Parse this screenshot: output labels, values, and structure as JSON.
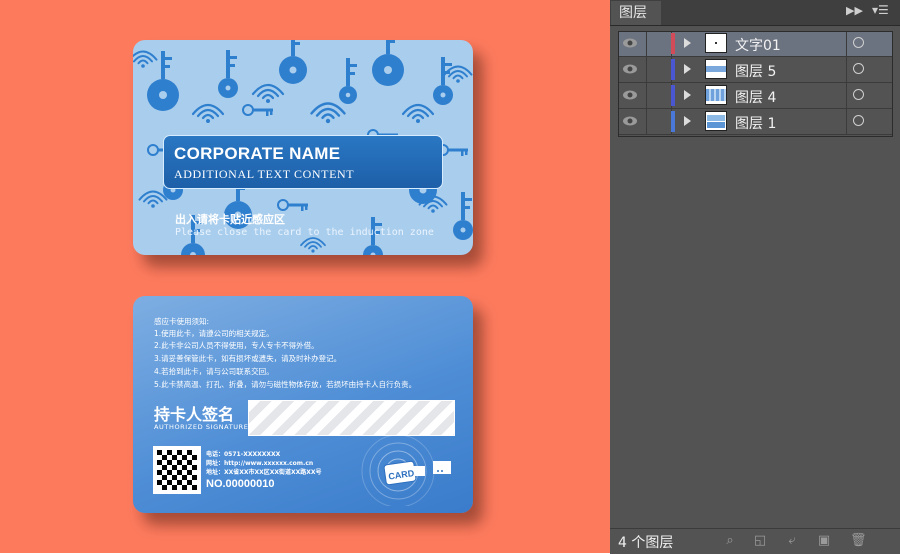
{
  "front_card": {
    "company_name": "CORPORATE NAME",
    "additional_text": "ADDITIONAL TEXT CONTENT",
    "instruction_cn": "出入请将卡贴近感应区",
    "instruction_en": "Please close the card to the induction zone"
  },
  "back_card": {
    "notice_title": "感应卡使用须知:",
    "notice_lines": [
      "1.使用此卡，请遵公司的相关规定。",
      "2.此卡非公司人员不得使用，专人专卡不得外借。",
      "3.请妥善保管此卡，如有损坏或遗失，请及时补办登记。",
      "4.若拾到此卡，请与公司联系交回。",
      "5.此卡禁高温、打孔、折叠，请勿与磁性物体存放，若损坏由持卡人自行负责。"
    ],
    "signature_label": "持卡人签名",
    "signature_sub": "AUTHORIZED SIGNATURE",
    "contact_lines": [
      "电话：0571-XXXXXXXX",
      "网址：http://www.xxxxxx.com.cn",
      "地址：XX省XX市XX区XX街道XX路XX号"
    ],
    "card_number": "NO.00000010",
    "card_icon_text": "CARD"
  },
  "layers_panel": {
    "tab_label": "图层",
    "layers": [
      {
        "name": "文字01",
        "color": "#d24b58",
        "selected": true,
        "thumb": "text"
      },
      {
        "name": "图层 5",
        "color": "#4a57d0",
        "selected": false,
        "thumb": "stripe"
      },
      {
        "name": "图层 4",
        "color": "#4a57d0",
        "selected": false,
        "thumb": "pattern"
      },
      {
        "name": "图层 1",
        "color": "#4a78d8",
        "selected": false,
        "thumb": "card"
      }
    ],
    "layer_count": "4 个图层",
    "footer_icons": [
      "locate-object-icon",
      "make-clipping-mask-icon",
      "create-sublayer-icon",
      "create-new-layer-icon",
      "delete-layer-icon"
    ]
  },
  "colors": {
    "canvas_bg": "#fd7a5d",
    "front_card_bg": "#a9cdec",
    "pattern_blue": "#2f7fcf",
    "panel_bg": "#535353"
  }
}
